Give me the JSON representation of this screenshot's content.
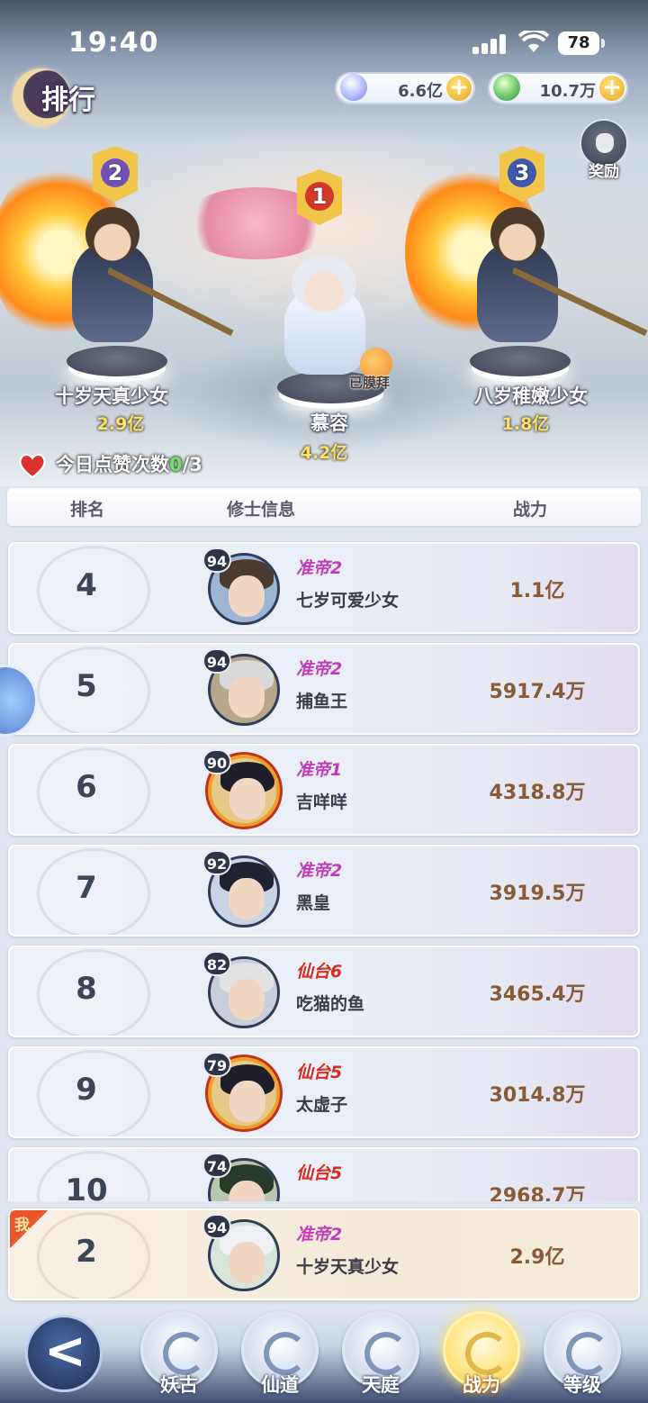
{
  "status_bar": {
    "time": "19:40",
    "battery": "78"
  },
  "header": {
    "title": "排行"
  },
  "currencies": [
    {
      "icon": "crystal-icon",
      "value": "6.6亿"
    },
    {
      "icon": "jade-dragon-icon",
      "value": "10.7万"
    }
  ],
  "reward": {
    "label": "奖励"
  },
  "podium": [
    {
      "rank": "1",
      "name": "慕容",
      "power": "4.2亿"
    },
    {
      "rank": "2",
      "name": "十岁天真少女",
      "power": "2.9亿"
    },
    {
      "rank": "3",
      "name": "八岁稚嫩少女",
      "power": "1.8亿"
    }
  ],
  "worship_label": "已膜拜",
  "likes": {
    "label": "今日点赞次数",
    "current": "0",
    "total": "/3"
  },
  "columns": {
    "rank": "排名",
    "info": "修士信息",
    "power": "战力"
  },
  "rows": [
    {
      "rank": "4",
      "level": "94",
      "realm": "准帝2",
      "name": "七岁可爱少女",
      "power": "1.1亿"
    },
    {
      "rank": "5",
      "level": "94",
      "realm": "准帝2",
      "name": "捕鱼王",
      "power": "5917.4万"
    },
    {
      "rank": "6",
      "level": "90",
      "realm": "准帝1",
      "name": "吉咩咩",
      "power": "4318.8万"
    },
    {
      "rank": "7",
      "level": "92",
      "realm": "准帝2",
      "name": "黑皇",
      "power": "3919.5万"
    },
    {
      "rank": "8",
      "level": "82",
      "realm": "仙台6",
      "name": "吃猫的鱼",
      "power": "3465.4万"
    },
    {
      "rank": "9",
      "level": "79",
      "realm": "仙台5",
      "name": "太虚子",
      "power": "3014.8万"
    },
    {
      "rank": "10",
      "level": "74",
      "realm": "仙台5",
      "name": "",
      "power": "2968.7万"
    }
  ],
  "my_row": {
    "tag": "我",
    "rank": "2",
    "level": "94",
    "realm": "准帝2",
    "name": "十岁天真少女",
    "power": "2.9亿"
  },
  "tabs": [
    {
      "label": "妖古",
      "active": false
    },
    {
      "label": "仙道",
      "active": false
    },
    {
      "label": "天庭",
      "active": false
    },
    {
      "label": "战力",
      "active": true
    },
    {
      "label": "等级",
      "active": false
    }
  ],
  "colors": {
    "realm_purple": "#c13bb6",
    "realm_red": "#d62b1f",
    "power_brown": "#8a5a36",
    "active_tab": "#ffe27a"
  }
}
